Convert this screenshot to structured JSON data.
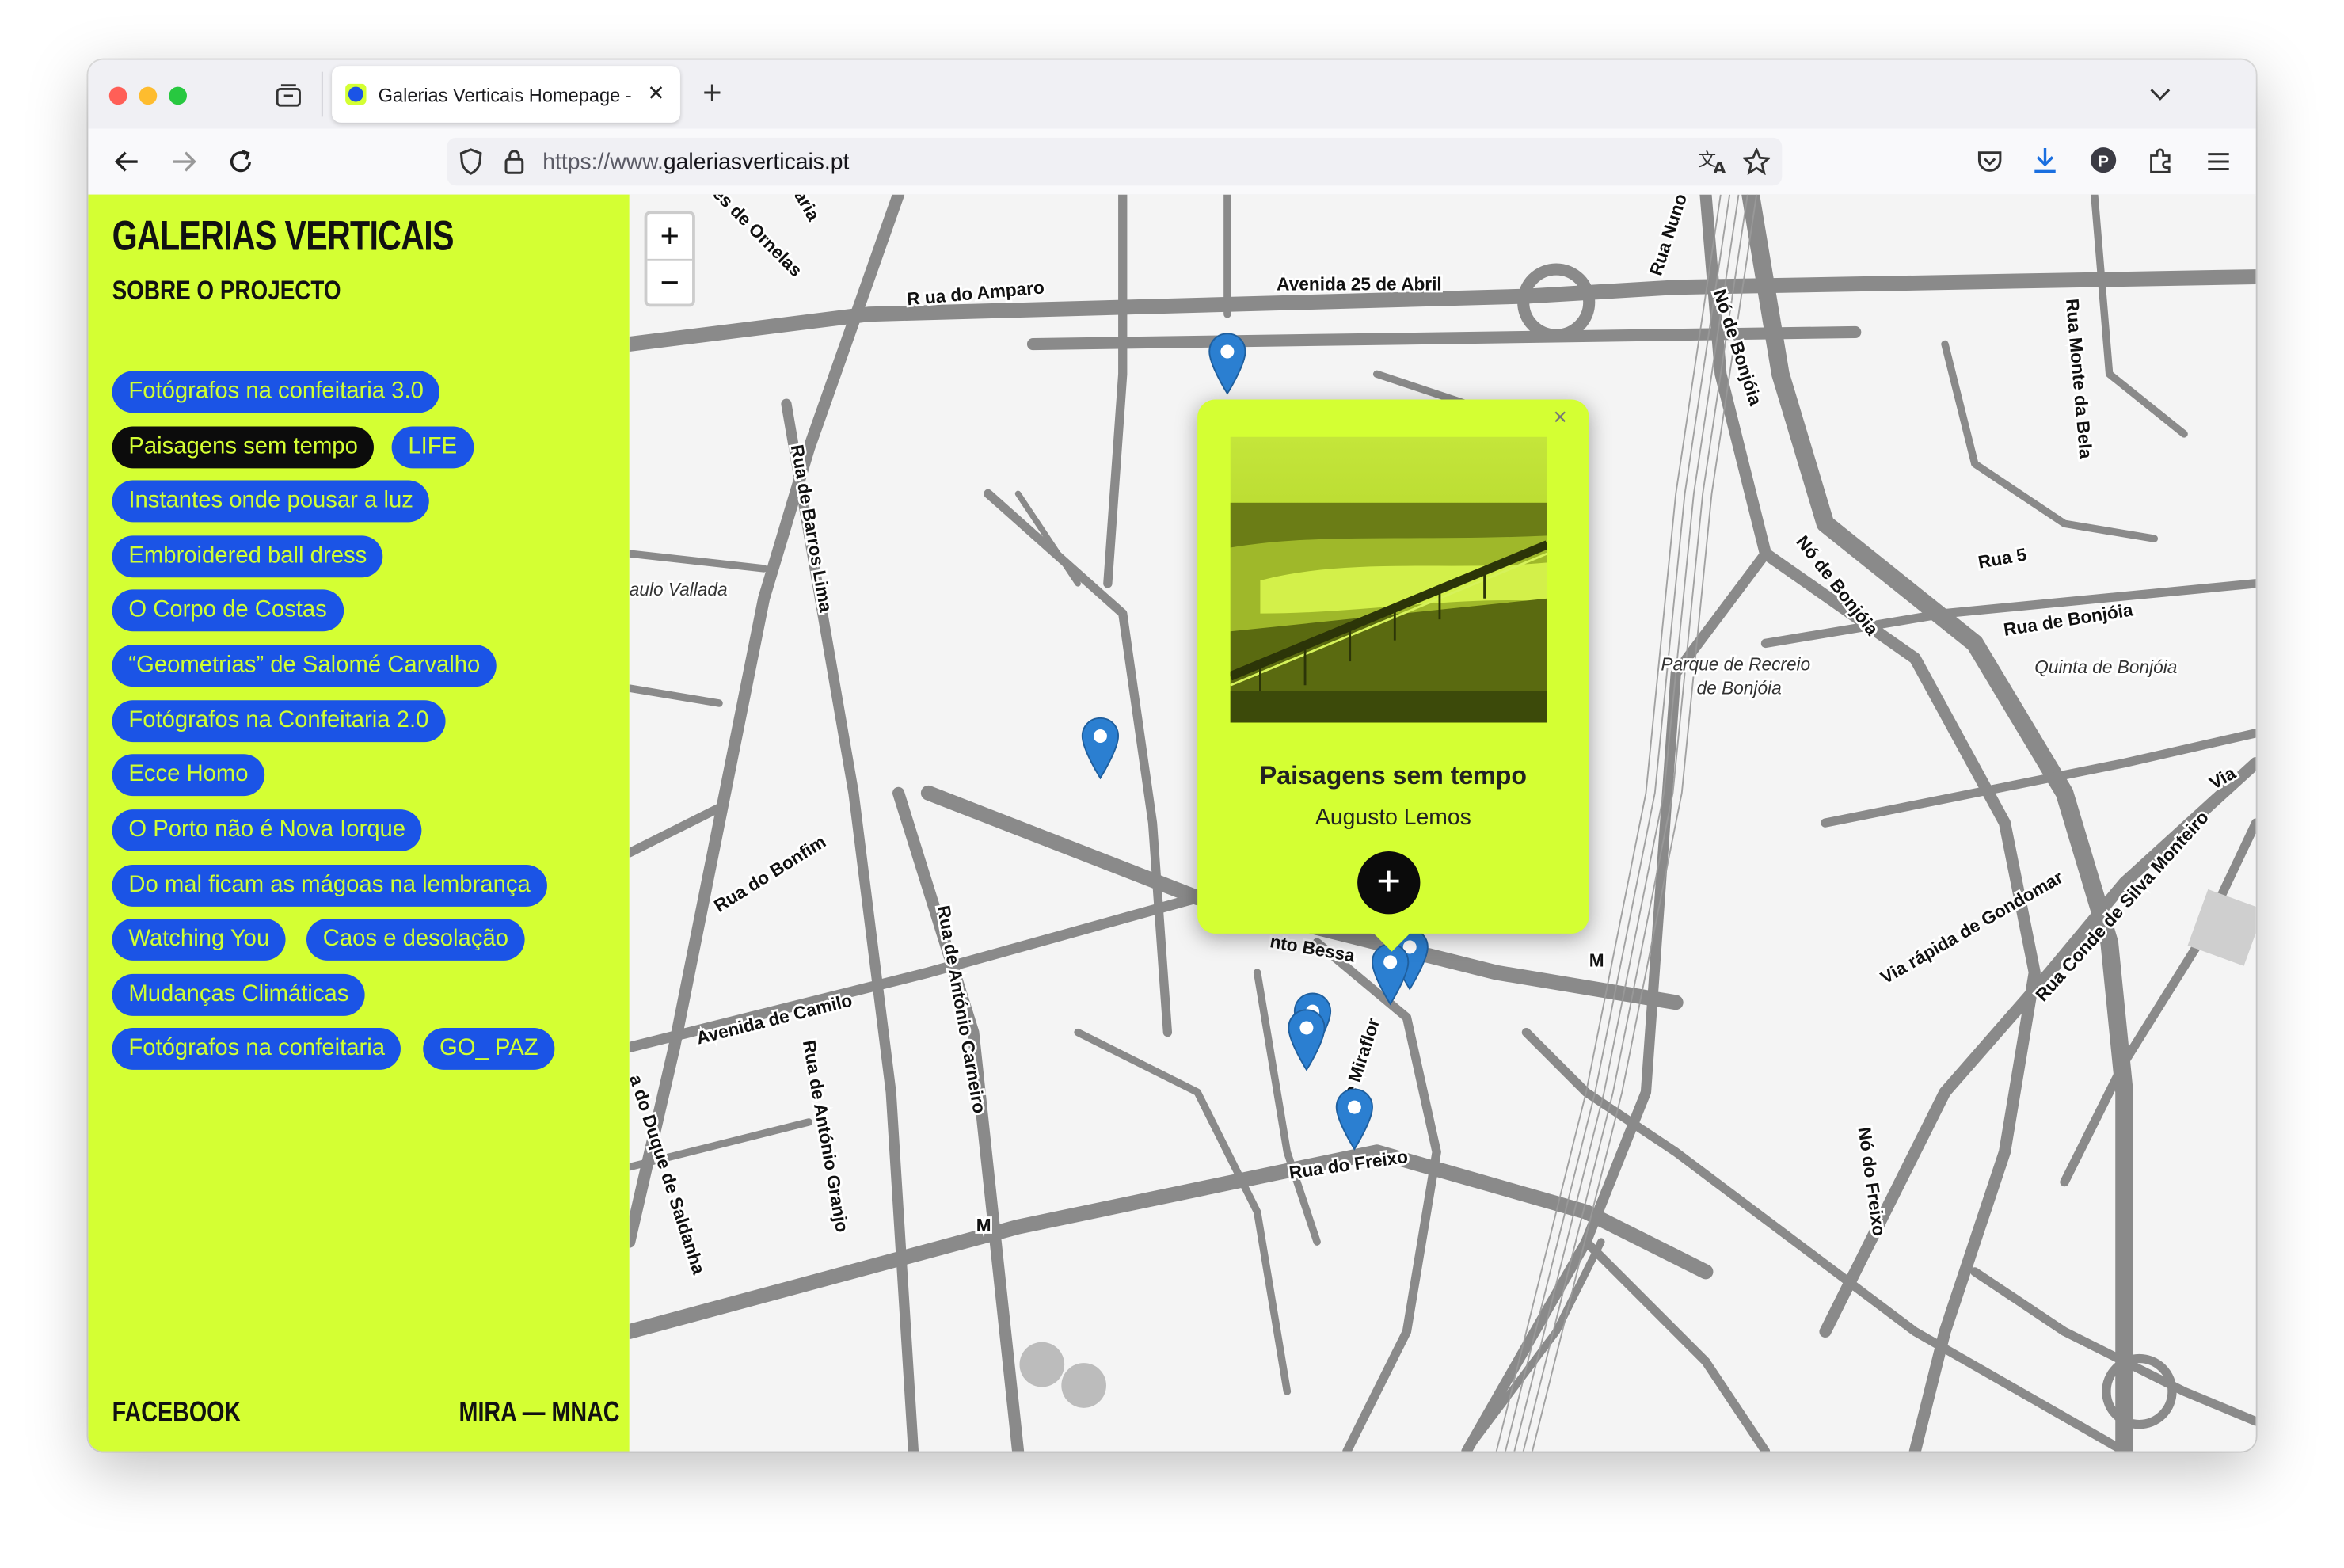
{
  "browser": {
    "tab_title": "Galerias Verticais Homepage - ",
    "url_prefix": "https://www.",
    "url_domain": "galeriasverticais.pt",
    "new_tab": "+",
    "tab_close": "✕"
  },
  "sidebar": {
    "brand": "GALERIAS VERTICAIS",
    "about": "SOBRE O PROJECTO",
    "galleries": [
      "Fotógrafos na confeitaria 3.0",
      "Paisagens sem tempo",
      "LIFE",
      "Instantes onde pousar a luz",
      "Embroidered ball dress",
      "O Corpo de Costas",
      "“Geometrias” de Salomé Carvalho",
      "Fotógrafos na Confeitaria 2.0",
      "Ecce Homo",
      "O Porto não é Nova Iorque",
      "Do mal ficam as mágoas na lembrança",
      "Watching You",
      "Caos e desolação",
      "Mudanças Climáticas",
      "Fotógrafos na confeitaria",
      "GO_ PAZ"
    ],
    "active_gallery": "Paisagens sem tempo",
    "footer_left": "FACEBOOK",
    "footer_right": "MIRA — MNAC"
  },
  "map": {
    "zoom_in": "+",
    "zoom_out": "−",
    "labels": {
      "amparo": "R ua do Amparo",
      "avenida25": "Avenida 25 de Abril",
      "ornelas": "es de Ornelas",
      "aria": "aria",
      "nuno": "Rua Nuno",
      "no_bonjoia_1": "Nó de Bonjóia",
      "no_bonjoia_2": "Nó de Bonjóia",
      "monte_bela": "Rua Monte da Bela",
      "barros_lima": "Rua de Barros Lima",
      "paulo": "aulo Vallada",
      "rua5": "Rua 5",
      "rua_bonjoia": "Rua de Bonjóia",
      "quinta": "Quinta de Bonjóia",
      "parque_1": "Parque de Recreio",
      "parque_2": "de Bonjóia",
      "bonfim": "Rua do Bonfim",
      "bessa": "nto Bessa",
      "antonio_carneiro": "Rua de António Carneiro",
      "camilo": "Avenida de Camilo",
      "antonio_granjo": "Rua de António Granjo",
      "duque": "a do Duque de Saldanha",
      "miraflor": "a de Miraflor",
      "freixo": "Rua do Freixo",
      "no_freixo": "Nó do Freixo",
      "via_rapida": "Via rápida de Gondomar",
      "silva_monteiro": "Rua Conde de Silva Monteiro",
      "via": "Via",
      "metro_1": "M",
      "metro_2": "M"
    },
    "popup": {
      "title": "Paisagens sem tempo",
      "author": "Augusto Lemos",
      "close": "×",
      "more": "+"
    },
    "marker_color": "#2b7fd1"
  },
  "colors": {
    "accent_lime": "#d4ff33",
    "chip_blue": "#1b54e6",
    "chip_active": "#0c0c0c"
  }
}
